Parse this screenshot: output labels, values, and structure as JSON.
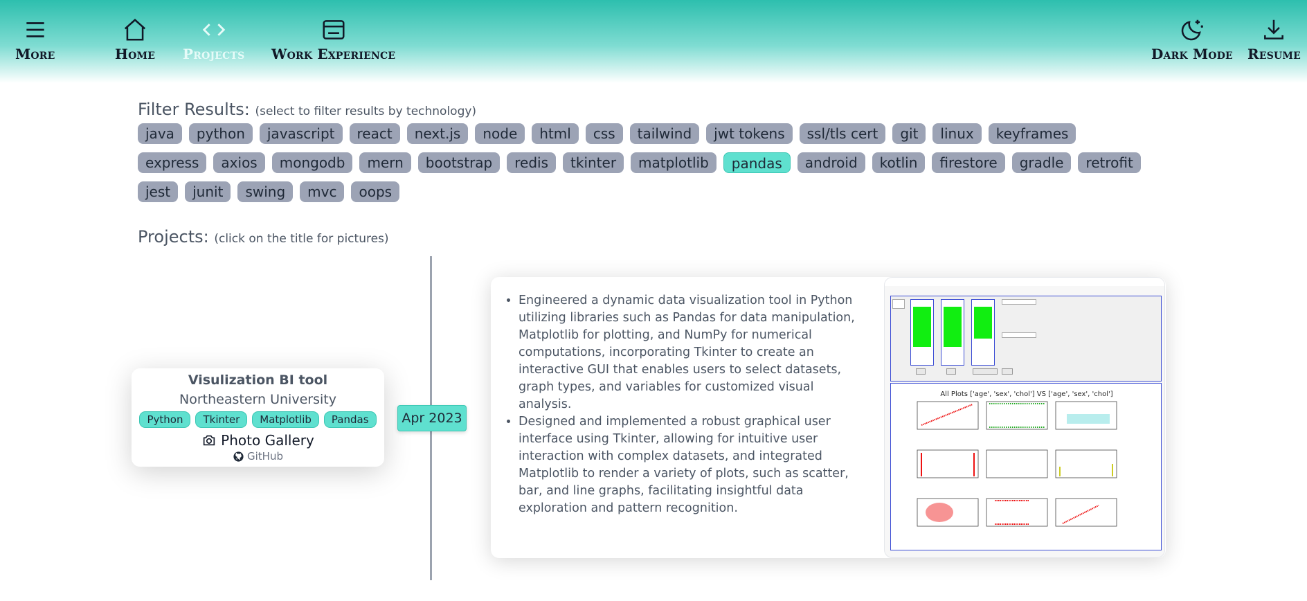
{
  "nav": {
    "more": "More",
    "home": "Home",
    "projects": "Projects",
    "work": "Work Experience",
    "dark": "Dark Mode",
    "resume": "Resume"
  },
  "filter": {
    "title": "Filter Results:",
    "hint": "(select to filter results by technology)",
    "tags": [
      "java",
      "python",
      "javascript",
      "react",
      "next.js",
      "node",
      "html",
      "css",
      "tailwind",
      "jwt tokens",
      "ssl/tls cert",
      "git",
      "linux",
      "keyframes",
      "express",
      "axios",
      "mongodb",
      "mern",
      "bootstrap",
      "redis",
      "tkinter",
      "matplotlib",
      "pandas",
      "android",
      "kotlin",
      "firestore",
      "gradle",
      "retrofit",
      "jest",
      "junit",
      "swing",
      "mvc",
      "oops"
    ],
    "selected": "pandas"
  },
  "projects": {
    "title": "Projects:",
    "hint": "(click on the title for pictures)"
  },
  "project": {
    "title": "Visulization BI tool",
    "org": "Northeastern University",
    "chips": [
      "Python",
      "Tkinter",
      "Matplotlib",
      "Pandas"
    ],
    "gallery": "Photo Gallery",
    "github": "GitHub",
    "date": "Apr 2023",
    "bullets": [
      "Engineered a dynamic data visualization tool in Python utilizing libraries such as Pandas for data manipulation, Matplotlib for plotting, and NumPy for numerical computations, incorporating Tkinter to create an interactive GUI that enables users to select datasets, graph types, and variables for customized visual analysis.",
      "Designed and implemented a robust graphical user interface using Tkinter, allowing for intuitive user interaction with complex datasets, and integrated Matplotlib to render a variety of plots, such as scatter, bar, and line graphs, facilitating insightful data exploration and pattern recognition."
    ],
    "screenshot_title": "All Plots ['age', 'sex', 'chol'] VS ['age', 'sex', 'chol']"
  },
  "colors": {
    "accent": "#5fe0cf",
    "tag": "#9ca3b5",
    "header": "#2dbfae"
  }
}
